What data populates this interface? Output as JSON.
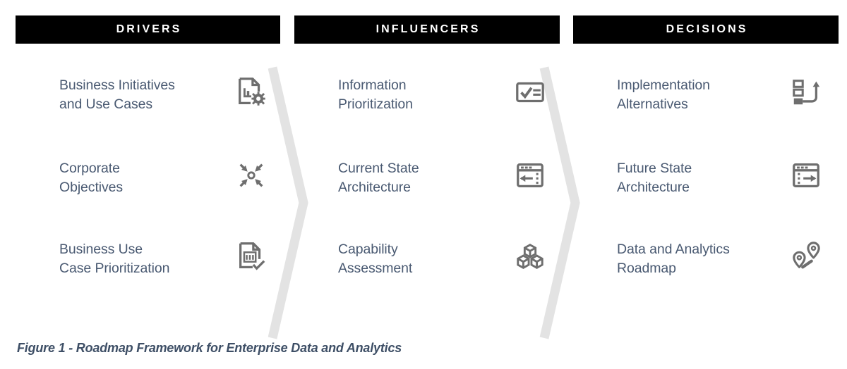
{
  "figure": {
    "caption": "Figure 1 - Roadmap Framework for Enterprise Data and Analytics",
    "background_color": "#ffffff",
    "header_bar_color": "#000000",
    "header_text_color": "#ffffff",
    "label_text_color": "#4a5a72",
    "icon_color": "#6e6e6e",
    "chevron_color": "#e3e3e3",
    "caption_text_color": "#3e4f66"
  },
  "columns": [
    {
      "header": "DRIVERS",
      "items": [
        {
          "label": "Business Initiatives\nand Use Cases",
          "icon": "document-chart-gear-icon"
        },
        {
          "label": "Corporate\nObjectives",
          "icon": "converge-target-icon"
        },
        {
          "label": "Business Use\nCase Prioritization",
          "icon": "document-chart-check-icon"
        }
      ]
    },
    {
      "header": "INFLUENCERS",
      "items": [
        {
          "label": "Information\nPrioritization",
          "icon": "checklist-box-icon"
        },
        {
          "label": "Current State\nArchitecture",
          "icon": "window-arrow-left-icon"
        },
        {
          "label": "Capability\nAssessment",
          "icon": "stacked-cubes-icon"
        }
      ]
    },
    {
      "header": "DECISIONS",
      "items": [
        {
          "label": "Implementation\nAlternatives",
          "icon": "options-return-arrow-icon"
        },
        {
          "label": "Future State\nArchitecture",
          "icon": "window-arrow-right-icon"
        },
        {
          "label": "Data and Analytics\nRoadmap",
          "icon": "map-pins-route-icon"
        }
      ]
    }
  ],
  "separators": [
    {
      "name": "chevron-drivers-to-influencers"
    },
    {
      "name": "chevron-influencers-to-decisions"
    }
  ]
}
